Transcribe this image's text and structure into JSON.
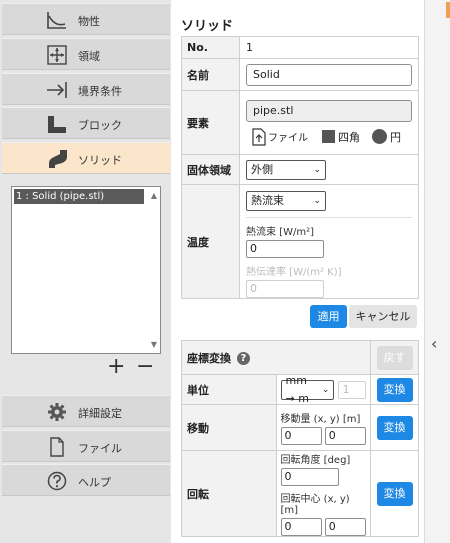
{
  "nav": {
    "items": [
      {
        "label": "物性",
        "icon": "chart-curve-icon"
      },
      {
        "label": "領域",
        "icon": "domain-move-icon"
      },
      {
        "label": "境界条件",
        "icon": "arrow-boundary-icon"
      },
      {
        "label": "ブロック",
        "icon": "block-icon"
      },
      {
        "label": "ソリッド",
        "icon": "pipe-elbow-icon",
        "active": true
      }
    ],
    "bottom_items": [
      {
        "label": "詳細設定",
        "icon": "gear-icon"
      },
      {
        "label": "ファイル",
        "icon": "file-icon"
      },
      {
        "label": "ヘルプ",
        "icon": "help-icon"
      }
    ],
    "list": {
      "items": [
        "1 : Solid (pipe.stl)"
      ]
    },
    "add_label": "+",
    "remove_label": "−"
  },
  "panel": {
    "title": "ソリッド",
    "no_label": "No.",
    "no_value": "1",
    "name_label": "名前",
    "name_value": "Solid",
    "element_label": "要素",
    "element_value": "pipe.stl",
    "elem_file_label": "ファイル",
    "elem_square_label": "四角",
    "elem_circle_label": "円",
    "solid_region_label": "固体領域",
    "solid_region_value": "外側",
    "temp_label": "温度",
    "temp_mode_value": "熱流束",
    "heat_flux_label": "熱流束 [W/m²]",
    "heat_flux_value": "0",
    "htc_label": "熱伝達率 [W/(m² K)]",
    "htc_value": "0",
    "apply_label": "適用",
    "cancel_label": "キャンセル"
  },
  "transform": {
    "title": "座標変換",
    "help_icon": "question-circle-icon",
    "back_label": "戻す",
    "unit_label": "単位",
    "unit_value": "mm → m",
    "unit_factor": "1",
    "move_label": "移動",
    "move_field_label": "移動量 (x, y) [m]",
    "move_x": "0",
    "move_y": "0",
    "rotate_label": "回転",
    "rot_angle_label": "回転角度 [deg]",
    "rot_angle": "0",
    "rot_center_label": "回転中心 (x, y) [m]",
    "rot_cx": "0",
    "rot_cy": "0",
    "convert_label": "変換"
  },
  "colors": {
    "accent": "#1e88e5",
    "active_nav": "#fbe6cc",
    "nav_bg": "#d9d9d9"
  }
}
